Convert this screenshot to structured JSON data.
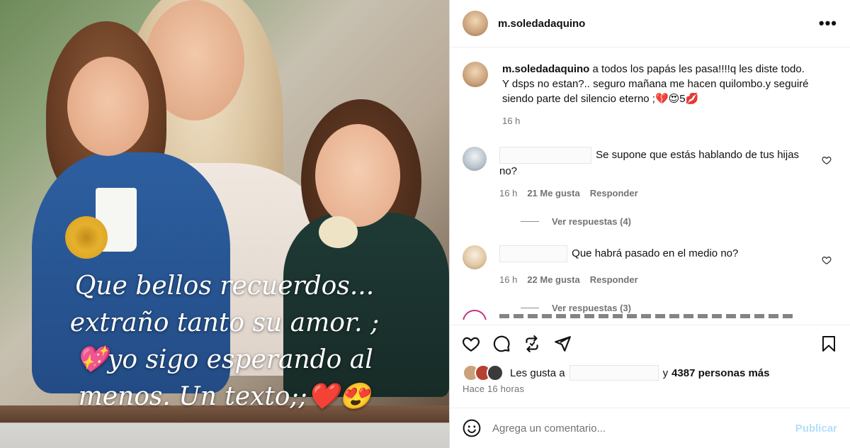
{
  "photo": {
    "overlay_lines": [
      "Que bellos recuerdos...",
      "extraño tanto su amor.  ;",
      "💖yo sigo esperando al",
      "menos. Un texto;;❤️😍"
    ]
  },
  "header": {
    "username": "m.soledadaquino",
    "more_label": "•••"
  },
  "caption": {
    "username": "m.soledadaquino",
    "text": "a todos los papás les pasa!!!!q les diste todo. Y dsps no estan?.. seguro mañana me hacen quilombo.y seguiré siendo parte del silencio eterno ;💔😍5💋",
    "time": "16 h"
  },
  "comments": [
    {
      "text": "Se supone que estás hablando de tus hijas no?",
      "time": "16 h",
      "likes": "21 Me gusta",
      "reply": "Responder",
      "view_replies": "Ver respuestas (4)"
    },
    {
      "text": "Que habrá pasado en el medio no?",
      "time": "16 h",
      "likes": "22 Me gusta",
      "reply": "Responder",
      "view_replies": "Ver respuestas (3)"
    }
  ],
  "likes": {
    "prefix": "Les gusta a",
    "connector": "y",
    "count_text": "4387 personas más"
  },
  "posted_time": "Hace 16 horas",
  "add_comment": {
    "placeholder": "Agrega un comentario...",
    "post_label": "Publicar"
  },
  "icons": [
    "heart-icon",
    "comment-icon",
    "repost-icon",
    "share-icon",
    "bookmark-icon",
    "emoji-icon",
    "more-icon"
  ]
}
